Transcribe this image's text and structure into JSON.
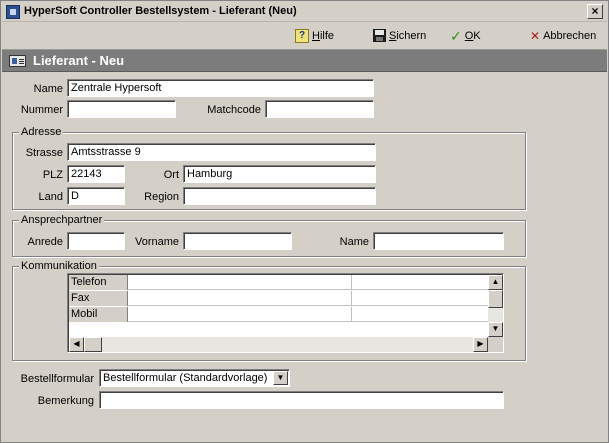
{
  "window": {
    "title": "HyperSoft Controller Bestellsystem - Lieferant (Neu)",
    "close_glyph": "×"
  },
  "toolbar": {
    "help_label_u": "H",
    "help_label_rest": "ilfe",
    "save_label_u": "S",
    "save_label_rest": "ichern",
    "ok_label_u": "O",
    "ok_label_rest": "K",
    "cancel_label": "Abbrechen",
    "help_icon": "help-icon",
    "save_icon": "floppy-disk-icon",
    "ok_icon": "checkmark-icon",
    "cancel_icon": "x-cross-icon"
  },
  "header": {
    "title": "Lieferant - Neu"
  },
  "form": {
    "name_label": "Name",
    "name_value": "Zentrale Hypersoft",
    "nummer_label": "Nummer",
    "nummer_value": "",
    "matchcode_label": "Matchcode",
    "matchcode_value": ""
  },
  "adresse": {
    "legend": "Adresse",
    "strasse_label": "Strasse",
    "strasse_value": "Amtsstrasse 9",
    "plz_label": "PLZ",
    "plz_value": "22143",
    "ort_label": "Ort",
    "ort_value": "Hamburg",
    "land_label": "Land",
    "land_value": "D",
    "region_label": "Region",
    "region_value": ""
  },
  "ansprechpartner": {
    "legend": "Ansprechpartner",
    "anrede_label": "Anrede",
    "anrede_value": "",
    "vorname_label": "Vorname",
    "vorname_value": "",
    "name_label": "Name",
    "name_value": ""
  },
  "kommunikation": {
    "legend": "Kommunikation",
    "rows": [
      {
        "label": "Telefon",
        "value1": "",
        "value2": ""
      },
      {
        "label": "Fax",
        "value1": "",
        "value2": ""
      },
      {
        "label": "Mobil",
        "value1": "",
        "value2": ""
      }
    ]
  },
  "bestellformular": {
    "label": "Bestellformular",
    "selected": "Bestellformular (Standardvorlage)"
  },
  "bemerkung": {
    "label": "Bemerkung",
    "value": ""
  }
}
